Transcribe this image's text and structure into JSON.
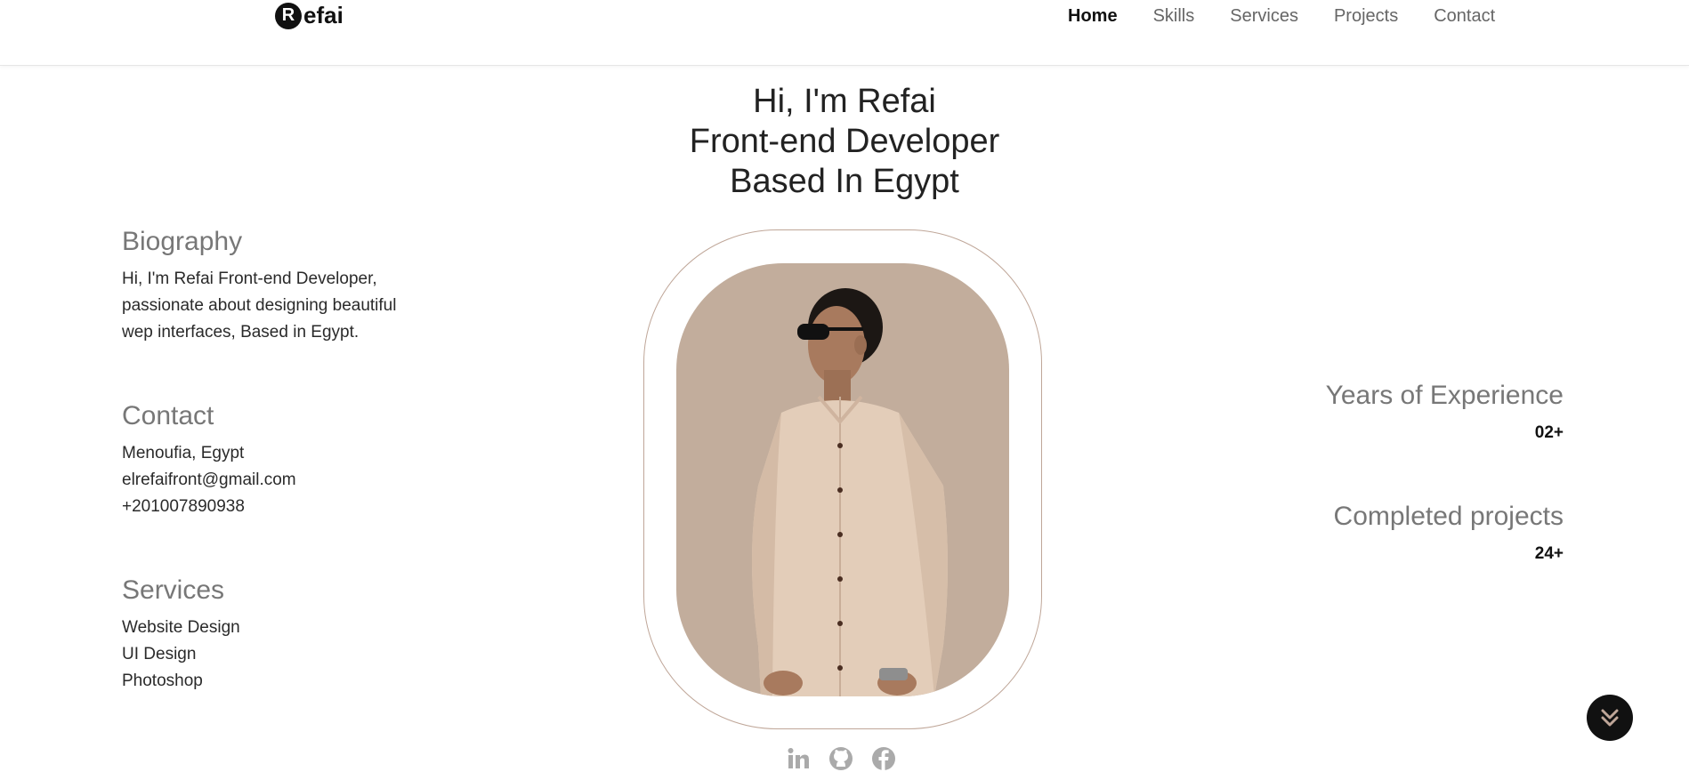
{
  "brand": {
    "badge_letter": "R",
    "name_rest": "efai"
  },
  "nav": {
    "links": [
      {
        "label": "Home",
        "active": true
      },
      {
        "label": "Skills",
        "active": false
      },
      {
        "label": "Services",
        "active": false
      },
      {
        "label": "Projects",
        "active": false
      },
      {
        "label": "Contact",
        "active": false
      }
    ]
  },
  "hero": {
    "line1": "Hi, I'm Refai",
    "line2": "Front-end Developer",
    "line3": "Based In Egypt"
  },
  "biography": {
    "heading": "Biography",
    "line1": "Hi, I'm Refai Front-end Developer,",
    "line2": "passionate about designing beautiful",
    "line3": "wep interfaces, Based in Egypt."
  },
  "contact": {
    "heading": "Contact",
    "location": "Menoufia, Egypt",
    "email": "elrefaifront@gmail.com",
    "phone": "+201007890938"
  },
  "services": {
    "heading": "Services",
    "items": [
      "Website Design",
      "UI Design",
      "Photoshop"
    ]
  },
  "stats": {
    "experience_label": "Years of Experience",
    "experience_value": "02+",
    "projects_label": "Completed projects",
    "projects_value": "24+"
  },
  "socials": {
    "icons": [
      "linkedin-icon",
      "github-icon",
      "facebook-icon"
    ]
  },
  "colors": {
    "accent_frame": "#bfa698",
    "photo_bg": "#c2ad9c",
    "icon_gray": "#aaaaaa"
  }
}
